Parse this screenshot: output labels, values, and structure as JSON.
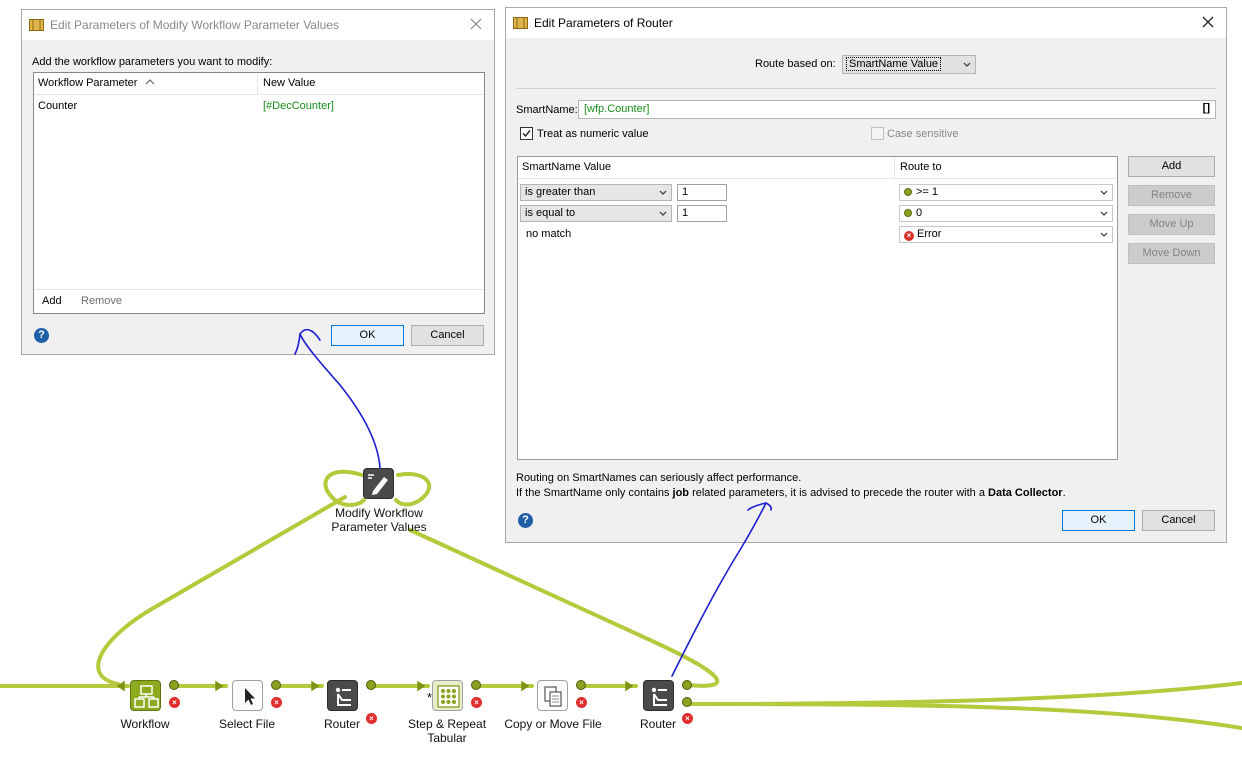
{
  "modify_dialog": {
    "title": "Edit Parameters of Modify Workflow Parameter Values",
    "instruction": "Add the workflow parameters you want to modify:",
    "col_parameter": "Workflow Parameter",
    "col_value": "New Value",
    "rows": [
      {
        "parameter": "Counter",
        "value": "[#DecCounter]"
      }
    ],
    "add_label": "Add",
    "remove_label": "Remove",
    "help": "?",
    "ok_label": "OK",
    "cancel_label": "Cancel"
  },
  "router_dialog": {
    "title": "Edit Parameters of Router",
    "route_based_on_label": "Route based on:",
    "route_based_on_value": "SmartName Value",
    "smartname_label": "SmartName:",
    "smartname_value": "[wfp.Counter]",
    "smartname_button": "[]",
    "treat_numeric_label": "Treat as numeric value",
    "treat_numeric_checked": true,
    "case_sensitive_label": "Case sensitive",
    "case_sensitive_checked": false,
    "col_value": "SmartName Value",
    "col_route": "Route to",
    "rules": [
      {
        "operator": "is greater than",
        "operand": "1",
        "route": ">= 1",
        "route_icon": "green-dot"
      },
      {
        "operator": "is equal to",
        "operand": "1",
        "route": "0",
        "route_icon": "green-dot"
      },
      {
        "operator": "no match",
        "operand": "",
        "route": "Error",
        "route_icon": "red-error"
      }
    ],
    "add_label": "Add",
    "remove_label": "Remove",
    "move_up_label": "Move Up",
    "move_down_label": "Move Down",
    "note_line1": "Routing on SmartNames can seriously affect performance.",
    "note_line2_a": "If the SmartName only contains ",
    "note_line2_b": "job",
    "note_line2_c": " related parameters, it is advised to precede the router with a ",
    "note_line2_d": "Data Collector",
    "note_line2_e": ".",
    "help": "?",
    "ok_label": "OK",
    "cancel_label": "Cancel"
  },
  "workflow": {
    "modify_node_label_1": "Modify Workflow",
    "modify_node_label_2": "Parameter Values",
    "nodes": [
      {
        "label": "Workflow",
        "icon": "workflow-icon"
      },
      {
        "label": "Select File",
        "icon": "cursor-icon"
      },
      {
        "label": "Router",
        "icon": "router-icon"
      },
      {
        "label_1": "Step & Repeat",
        "label_2": "Tabular",
        "icon": "grid-icon"
      },
      {
        "label": "Copy or Move File",
        "icon": "copy-icon"
      },
      {
        "label": "Router",
        "icon": "router-icon"
      }
    ],
    "error_glyph": "×"
  },
  "colors": {
    "connector": "#8da01f",
    "annotation": "#1c1cd0",
    "accent": "#0078d7"
  }
}
